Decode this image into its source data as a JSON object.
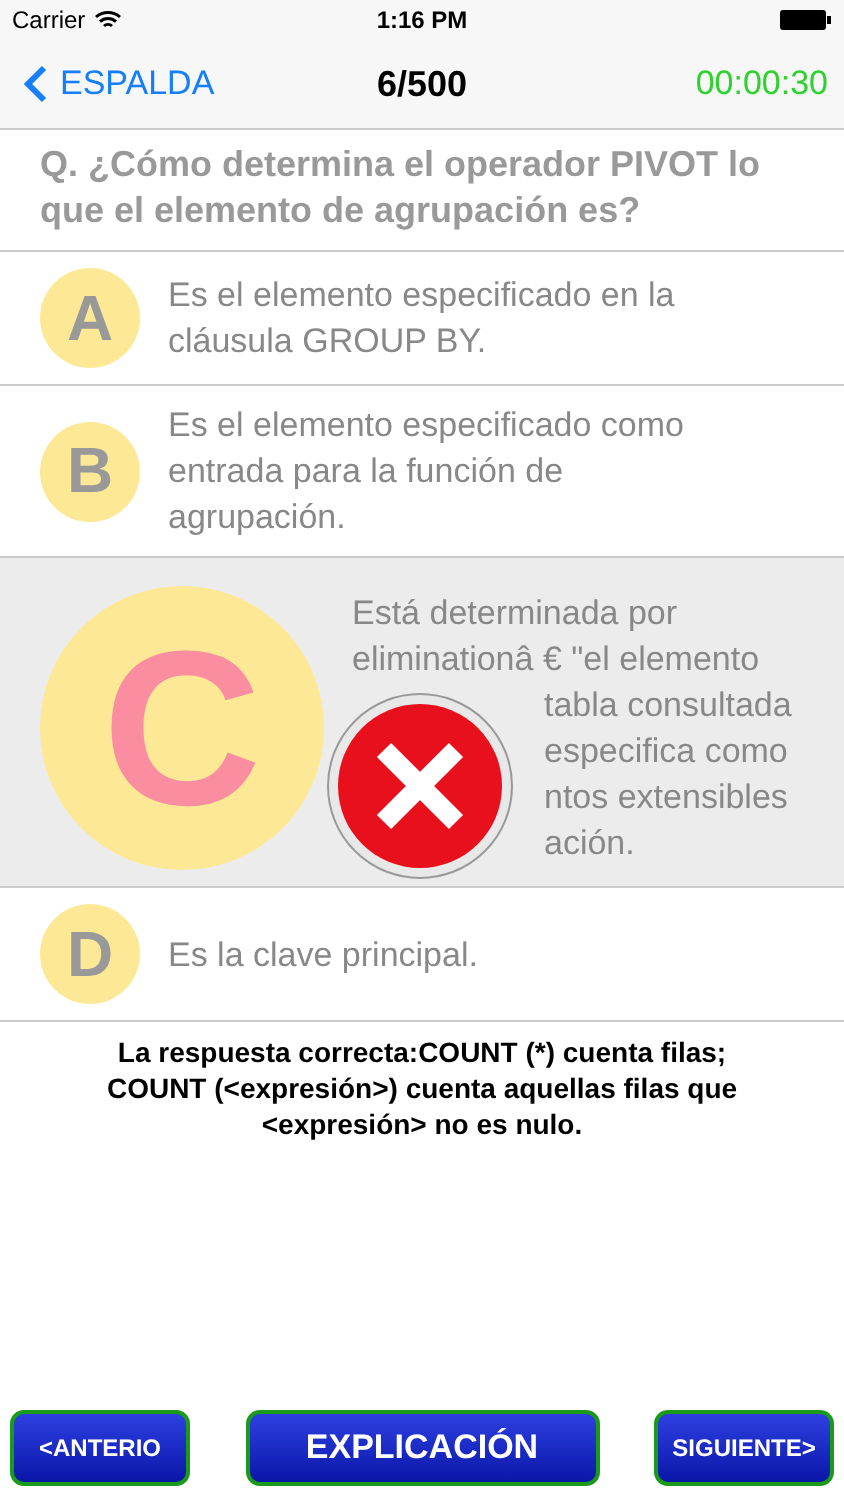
{
  "status_bar": {
    "carrier": "Carrier",
    "time": "1:16 PM"
  },
  "nav": {
    "back": "ESPALDA",
    "counter": "6/500",
    "timer": "00:00:30"
  },
  "question": "Q. ¿Cómo determina el operador PIVOT lo que el elemento de agrupación es?",
  "options": [
    {
      "letter": "A",
      "selected": false,
      "wrong": false,
      "lines": [
        {
          "text": "Es el elemento especificado en la cláusula GROUP BY.",
          "covered": false
        }
      ]
    },
    {
      "letter": "B",
      "selected": false,
      "wrong": false,
      "lines": [
        {
          "text": "Es el elemento especificado como entrada para la función de agrupación.",
          "covered": false
        }
      ]
    },
    {
      "letter": "C",
      "selected": true,
      "wrong": true,
      "lines": [
        {
          "text": "Está determinada por",
          "covered": false
        },
        {
          "text": "eliminationâ € \"el elemento",
          "covered": false
        },
        {
          "text": "tabla consultada",
          "covered": true
        },
        {
          "text": "especifica como",
          "covered": true
        },
        {
          "text": "ntos extensibles",
          "covered": true
        },
        {
          "text": "ación.",
          "covered": true
        }
      ]
    },
    {
      "letter": "D",
      "selected": false,
      "wrong": false,
      "lines": [
        {
          "text": "Es la clave principal.",
          "covered": false
        }
      ]
    }
  ],
  "answer": "La respuesta correcta:COUNT (*) cuenta filas; COUNT (<expresión>) cuenta aquellas filas que <expresión> no es nulo.",
  "buttons": [
    {
      "label": "<ANTERIO",
      "kind": "small"
    },
    {
      "label": "EXPLICACIÓN",
      "kind": "wide"
    },
    {
      "label": "SIGUIENTE>",
      "kind": "small"
    }
  ]
}
